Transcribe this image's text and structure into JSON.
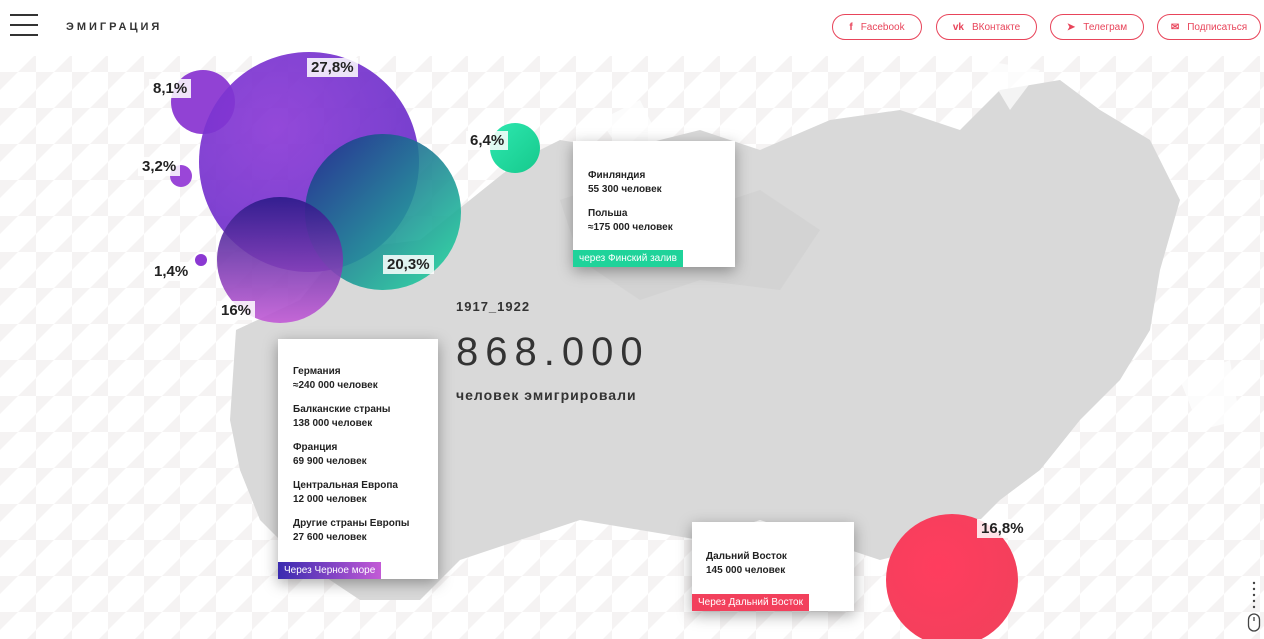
{
  "header": {
    "brand": "ЭМИГРАЦИЯ",
    "social": [
      {
        "label": "Facebook",
        "icon": "f",
        "icon_name": "facebook-icon"
      },
      {
        "label": "ВКонтакте",
        "icon": "vk",
        "icon_name": "vk-icon"
      },
      {
        "label": "Телеграм",
        "icon": "➤",
        "icon_name": "telegram-icon"
      },
      {
        "label": "Подписаться",
        "icon": "✉",
        "icon_name": "mail-icon"
      }
    ]
  },
  "colors": {
    "accent": "#e8445a",
    "purple": "#7b2fd0",
    "green": "#1fd39a",
    "red": "#f73b5a",
    "map": "#d8d8d8"
  },
  "percentages": {
    "germany": "27,8%",
    "left_small_1": "8,1%",
    "left_small_2": "3,2%",
    "left_small_3": "1,4%",
    "bottom": "16%",
    "green_big": "20,3%",
    "green_small": "6,4%",
    "far_east": "16,8%"
  },
  "stats": {
    "years": "1917_1922",
    "total": "868.000",
    "caption": "человек эмигрировали"
  },
  "cards": {
    "finland": {
      "entries": [
        {
          "name": "Финляндия",
          "value": "55 300 человек"
        },
        {
          "name": "Польша",
          "value": "≈175 000 человек"
        }
      ],
      "route": "через Финский залив"
    },
    "black_sea": {
      "entries": [
        {
          "name": "Германия",
          "value": "≈240 000 человек"
        },
        {
          "name": "Балканские страны",
          "value": "138 000 человек"
        },
        {
          "name": "Франция",
          "value": "69 900 человек"
        },
        {
          "name": "Центральная Европа",
          "value": "12 000 человек"
        },
        {
          "name": "Другие страны Европы",
          "value": "27 600 человек"
        }
      ],
      "route": "Через Черное море"
    },
    "far_east": {
      "entries": [
        {
          "name": "Дальний Восток",
          "value": "145 000 человек"
        }
      ],
      "route": "Через Дальний Восток"
    }
  }
}
